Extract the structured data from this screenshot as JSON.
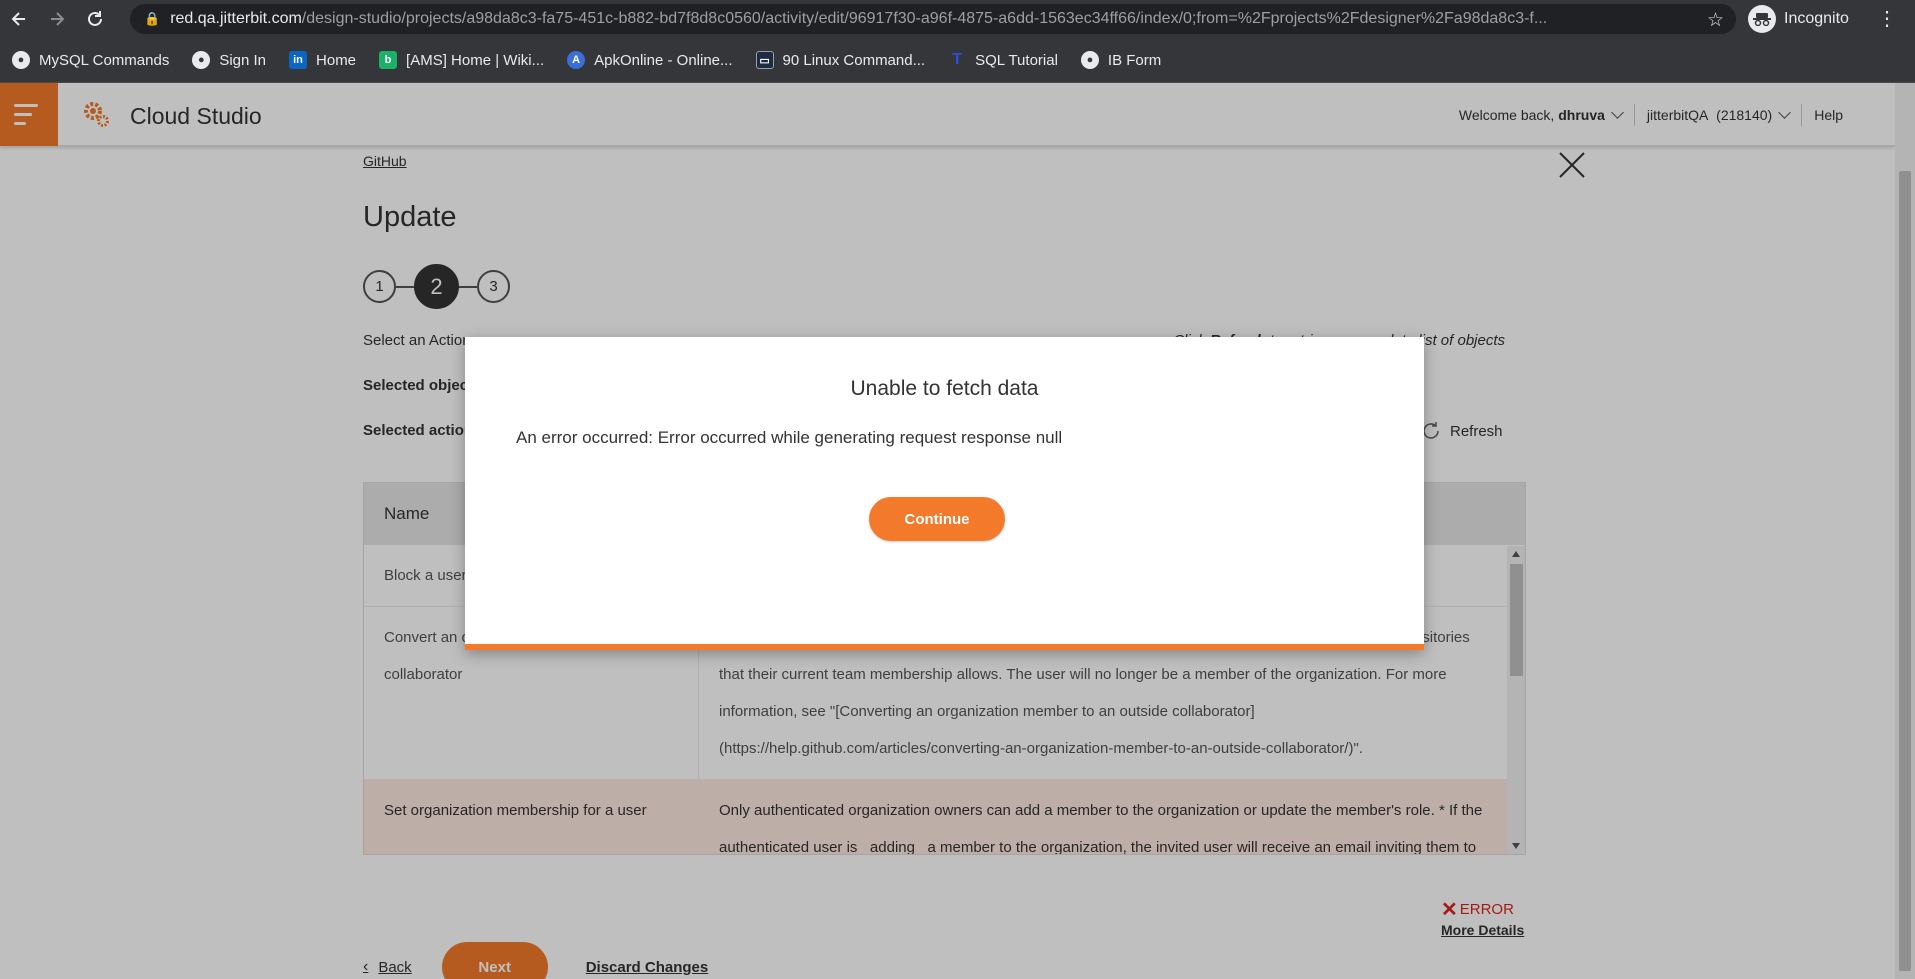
{
  "browser": {
    "url_host": "red.qa.jitterbit.com",
    "url_path": "/design-studio/projects/a98da8c3-fa75-451c-b882-bd7f8d8c0560/activity/edit/96917f30-a96f-4875-a6dd-1563ec34ff66/index/0;from=%2Fprojects%2Fdesigner%2Fa98da8c3-f...",
    "profile": "Incognito",
    "bookmarks": [
      {
        "label": "MySQL Commands",
        "icon": "globe-icon"
      },
      {
        "label": "Sign In",
        "icon": "globe-icon"
      },
      {
        "label": "Home",
        "icon": "linkedin-icon"
      },
      {
        "label": "[AMS] Home | Wiki...",
        "icon": "wiki-icon"
      },
      {
        "label": "ApkOnline - Online...",
        "icon": "apk-icon"
      },
      {
        "label": "90 Linux Command...",
        "icon": "terminal-icon"
      },
      {
        "label": "SQL Tutorial",
        "icon": "tutorial-icon"
      },
      {
        "label": "IB Form",
        "icon": "globe-icon"
      }
    ]
  },
  "header": {
    "app_title": "Cloud Studio",
    "welcome_prefix": "Welcome back,",
    "user": "dhruva",
    "org": "jitterbitQA",
    "org_id": "(218140)",
    "help": "Help",
    "brand_color": "#f37a2a"
  },
  "page": {
    "breadcrumb": "GitHub",
    "title": "Update",
    "steps": [
      "1",
      "2",
      "3"
    ],
    "active_step": "2",
    "select_action_label": "Select an Action",
    "hint_prefix": "Click",
    "hint_bold": "Refresh",
    "hint_suffix": "to retrieve a complete list of objects",
    "selected_object": "Selected object: orgs",
    "selected_action": "Selected action",
    "refresh_label": "Refresh",
    "table": {
      "column_name": "Name",
      "rows": [
        {
          "name": "Block a user",
          "desc": ""
        },
        {
          "name": "Convert an organization member to outside collaborator",
          "desc": "When an organization member is converted to an outside collaborator, they'll only have access to the repositories that their current team membership allows. The user will no longer be a member of the organization. For more information, see \"[Converting an organization member to an outside collaborator](https://help.github.com/articles/converting-an-organization-member-to-an-outside-collaborator/)\"."
        },
        {
          "name": "Set organization membership for a user",
          "desc": "Only authenticated organization owners can add a member to the organization or update the member's role. * If the authenticated user is _adding_ a member to the organization, the invited user will receive an email inviting them to"
        }
      ]
    },
    "error_label": "ERROR",
    "more_details": "More Details",
    "back": "Back",
    "next": "Next",
    "discard": "Discard Changes"
  },
  "modal": {
    "title": "Unable to fetch data",
    "message": "An error occurred: Error occurred while generating request response null",
    "button": "Continue"
  }
}
